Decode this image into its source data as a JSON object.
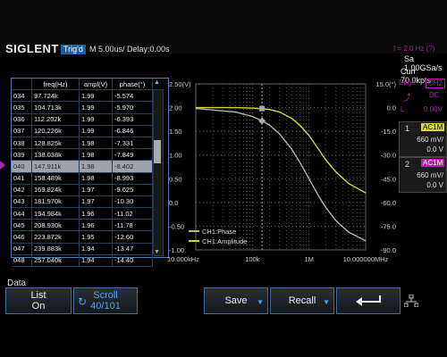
{
  "topbar": {
    "brand": "SIGLENT",
    "trigger": "Trig'd",
    "timebase": "M 5.00us/  Delay:0.00s",
    "status_right": "f = 2.0 Hz (?)"
  },
  "right_panel": {
    "sample_rate": "Sa 1.00GSa/s",
    "curr_points": "Curr 70.0kpts",
    "edge_label": "Edge",
    "edge_channel": "CH2",
    "edge_mode": "DC",
    "level_label": "L",
    "level_value": "0.00V",
    "ch1": {
      "num": "1",
      "coupling": "AC1M",
      "scale": "660 mV/",
      "offset": "0.0 V"
    },
    "ch2": {
      "num": "2",
      "coupling": "AC1M",
      "scale": "660 mV/",
      "offset": "0.0 V"
    }
  },
  "table": {
    "headers": [
      "",
      "freq(Hz)",
      "ampl(V)",
      "phase(°)"
    ],
    "rows": [
      [
        "034",
        "97.724k",
        "1.99",
        "-5.574"
      ],
      [
        "035",
        "104.713k",
        "1.99",
        "-5.970"
      ],
      [
        "036",
        "112.202k",
        "1.99",
        "-6.393"
      ],
      [
        "037",
        "120.226k",
        "1.99",
        "-6.846"
      ],
      [
        "038",
        "128.825k",
        "1.98",
        "-7.331"
      ],
      [
        "039",
        "138.038k",
        "1.98",
        "-7.849"
      ],
      [
        "040",
        "147.911k",
        "1.98",
        "-8.402"
      ],
      [
        "041",
        "158.489k",
        "1.98",
        "-8.993"
      ],
      [
        "042",
        "169.824k",
        "1.97",
        "-9.625"
      ],
      [
        "043",
        "181.970k",
        "1.97",
        "-10.30"
      ],
      [
        "044",
        "194.984k",
        "1.96",
        "-11.02"
      ],
      [
        "045",
        "208.930k",
        "1.96",
        "-11.78"
      ],
      [
        "046",
        "223.872k",
        "1.95",
        "-12.60"
      ],
      [
        "047",
        "239.883k",
        "1.94",
        "-13.47"
      ],
      [
        "048",
        "257.040k",
        "1.94",
        "-14.40"
      ]
    ],
    "selected_index": 6
  },
  "chart_data": {
    "type": "line",
    "x_scale": "log",
    "x_ticks": [
      "10.000kHz",
      "100k",
      "1M",
      "10.000000MHz"
    ],
    "x_tick_values": [
      10000,
      100000,
      1000000,
      10000000
    ],
    "y_left_ticks": [
      "2.50(V)",
      "2.00",
      "1.50",
      "1.00",
      "0.50",
      "0.0",
      "-0.50",
      "-1.00"
    ],
    "y_left_range": [
      -1.0,
      2.5
    ],
    "y_right_ticks": [
      "15.0(°)",
      "0.0",
      "-15.0",
      "-30.0",
      "-45.0",
      "-60.0",
      "-75.0",
      "-90.0"
    ],
    "y_right_range": [
      -90,
      15
    ],
    "legend": [
      "CH1:Phase",
      "CH1:Amplitude"
    ],
    "cursor_freq": 147911,
    "series": [
      {
        "name": "CH1:Amplitude",
        "color": "#d8d83a",
        "x": [
          10000,
          50000,
          100000,
          200000,
          300000,
          500000,
          700000,
          1000000,
          1500000,
          2000000,
          3000000,
          5000000,
          10000000
        ],
        "y": [
          2.0,
          2.0,
          1.99,
          1.96,
          1.91,
          1.77,
          1.62,
          1.41,
          1.11,
          0.89,
          0.64,
          0.4,
          0.2
        ]
      },
      {
        "name": "CH1:Phase",
        "color": "#b7b59a",
        "x": [
          10000,
          50000,
          100000,
          150000,
          200000,
          300000,
          500000,
          700000,
          1000000,
          1500000,
          2000000,
          3000000,
          5000000,
          10000000
        ],
        "y": [
          -0.6,
          -2.8,
          -5.6,
          -8.4,
          -11.0,
          -16.5,
          -26.6,
          -35.0,
          -45.0,
          -56.3,
          -63.4,
          -71.6,
          -78.7,
          -84.3
        ]
      }
    ]
  },
  "bottom": {
    "title": "Data",
    "list_label": "List",
    "list_value": "On",
    "scroll_label": "Scroll",
    "scroll_value": "40/101",
    "save_label": "Save",
    "recall_label": "Recall"
  },
  "colors": {
    "accent": "#b220b0",
    "table_border": "#4a82c0",
    "button_border": "#3c6ea8",
    "trig_blue": "#1f5fa0"
  }
}
